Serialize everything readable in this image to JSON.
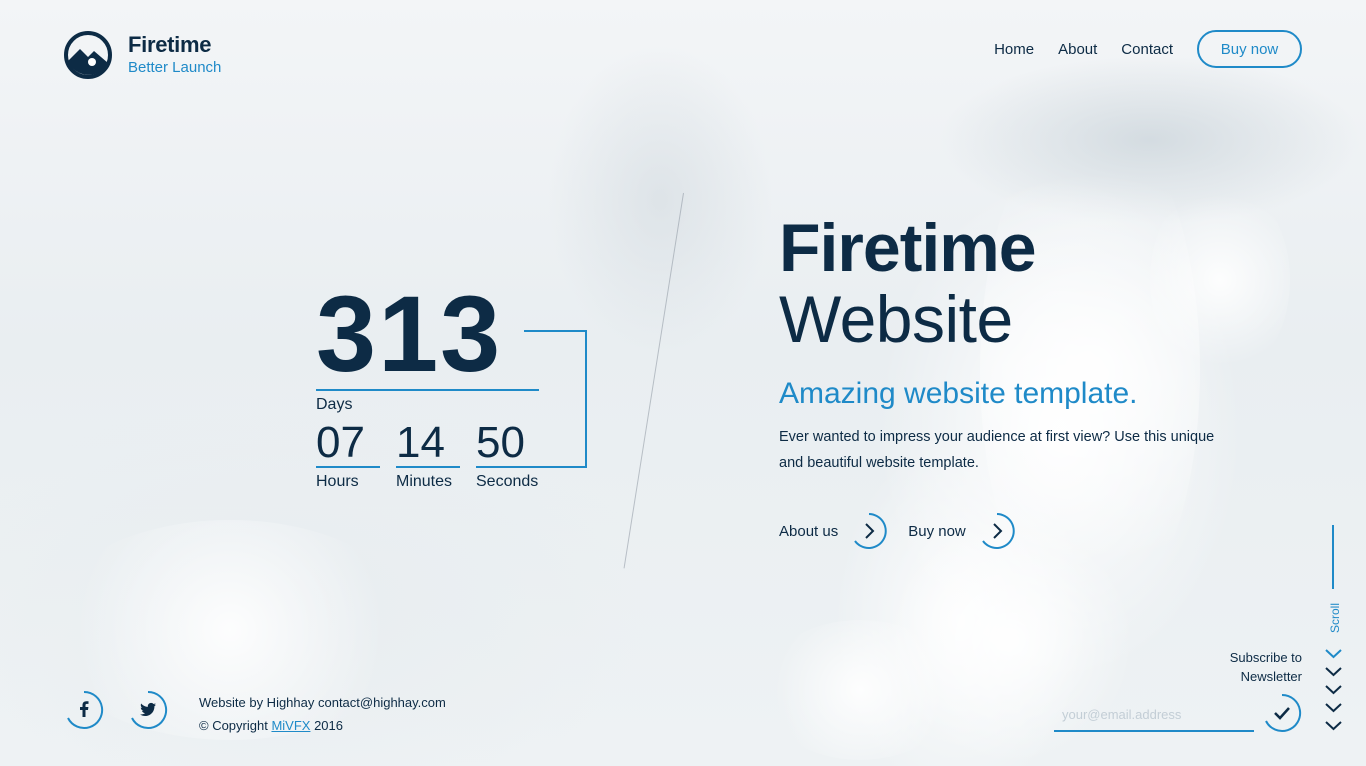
{
  "brand": {
    "name": "Firetime",
    "tagline": "Better Launch"
  },
  "nav": {
    "items": [
      "Home",
      "About",
      "Contact"
    ],
    "cta_label": "Buy now"
  },
  "countdown": {
    "days": "313",
    "days_label": "Days",
    "hours": "07",
    "hours_label": "Hours",
    "minutes": "14",
    "minutes_label": "Minutes",
    "seconds": "50",
    "seconds_label": "Seconds"
  },
  "hero": {
    "title": "Firetime",
    "subtitle": "Website",
    "tagline": "Amazing website template.",
    "description": "Ever wanted to impress your audience at first view? Use this unique and beautiful website template.",
    "ctas": [
      {
        "label": "About us",
        "icon": "chevron-right-icon"
      },
      {
        "label": "Buy now",
        "icon": "chevron-right-icon"
      }
    ]
  },
  "footer": {
    "social": [
      "facebook-icon",
      "twitter-icon"
    ],
    "credit_line": "Website by Highhay contact@highhay.com",
    "copyright_prefix": "© Copyright ",
    "copyright_link": "MiVFX",
    "copyright_suffix": " 2016"
  },
  "newsletter": {
    "label_line1": "Subscribe to",
    "label_line2": "Newsletter",
    "placeholder": "your@email.address",
    "submit_icon": "check-icon"
  },
  "scroll": {
    "label": "Scroll"
  },
  "colors": {
    "accent": "#1f8ac8",
    "text": "#0d2b45"
  }
}
